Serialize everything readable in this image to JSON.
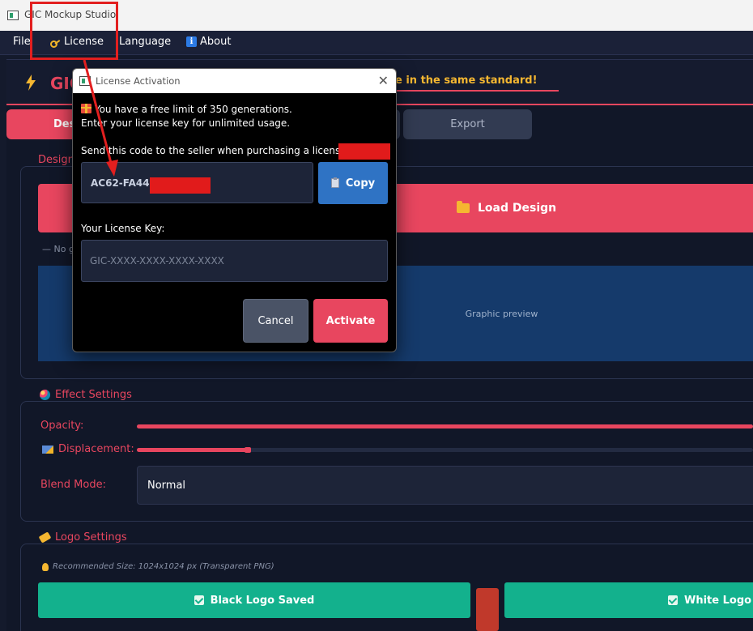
{
  "window": {
    "title": "GIC Mockup Studio"
  },
  "menu": {
    "file": "File",
    "license": "License",
    "language": "Language",
    "about": "About"
  },
  "app": {
    "brand": "GIC",
    "tagline": "e in the same standard!",
    "tabs": {
      "design": "Des",
      "export": "Export"
    },
    "design_section": {
      "title": "Design",
      "load_button": "Load Design",
      "status": "— No g",
      "preview": "Graphic preview"
    },
    "effect_section": {
      "title": "Effect Settings",
      "opacity_label": "Opacity:",
      "displacement_label": "Displacement:",
      "opacity_level": 1.0,
      "displacement_level": 0.18,
      "blend_label": "Blend Mode:",
      "blend_value": "Normal"
    },
    "logo_section": {
      "title": "Logo Settings",
      "recommended": "Recommended Size: 1024x1024 px (Transparent PNG)",
      "black_logo": "Black Logo Saved",
      "white_logo": "White Logo Sa"
    }
  },
  "dialog": {
    "title": "License Activation",
    "free_limit_line1": "You have a free limit of 350 generations.",
    "free_limit_line2": "Enter your license key for unlimited usage.",
    "send_code_label": "Send this code to the seller when purchasing a license",
    "machine_code": "AC62-FA44-9",
    "copy_button": "Copy",
    "license_key_label": "Your License Key:",
    "license_key_placeholder": "GIC-XXXX-XXXX-XXXX-XXXX",
    "license_key_value": "",
    "cancel_button": "Cancel",
    "activate_button": "Activate"
  },
  "colors": {
    "accent": "#e8465f",
    "background": "#111728",
    "copy_button": "#2f73c4",
    "success": "#13b18d",
    "highlight": "#f5b731",
    "annotation": "#e21f1f"
  }
}
